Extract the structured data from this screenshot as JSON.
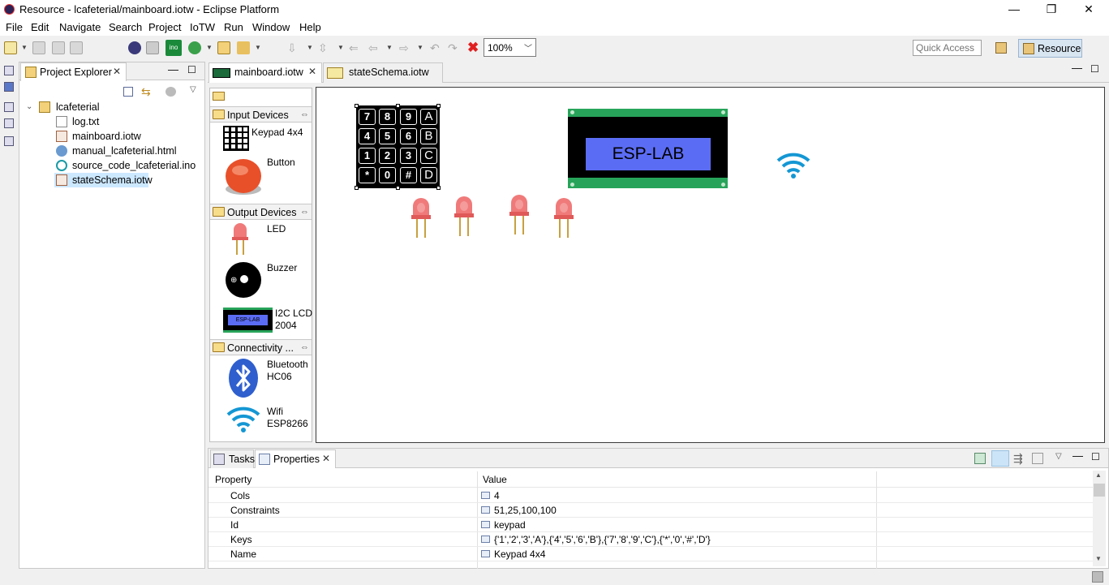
{
  "window": {
    "title": "Resource - lcafeterial/mainboard.iotw - Eclipse Platform",
    "min": "—",
    "max": "❐",
    "close": "✕"
  },
  "menu": [
    "File",
    "Edit",
    "Navigate",
    "Search",
    "Project",
    "IoTW",
    "Run",
    "Window",
    "Help"
  ],
  "toolbar": {
    "zoom": "100%",
    "quick_access_placeholder": "Quick Access",
    "perspective": "Resource"
  },
  "project_explorer": {
    "title": "Project Explorer",
    "project": "lcafeterial",
    "files": [
      "log.txt",
      "mainboard.iotw",
      "manual_lcafeterial.html",
      "source_code_lcafeterial.ino",
      "stateSchema.iotw"
    ],
    "selected": "stateSchema.iotw"
  },
  "editor": {
    "tabs": [
      "mainboard.iotw",
      "stateSchema.iotw"
    ],
    "active_tab": "mainboard.iotw"
  },
  "palette": {
    "groups": [
      {
        "title": "Input Devices",
        "items": [
          "Keypad 4x4",
          "Button"
        ]
      },
      {
        "title": "Output Devices",
        "items": [
          "LED",
          "Buzzer",
          "I2C LCD\n2004"
        ]
      },
      {
        "title": "Connectivity ...",
        "items": [
          "Bluetooth\nHC06",
          "Wifi\nESP8266"
        ]
      }
    ],
    "lcd_icon_text": "ESP-LAB"
  },
  "canvas": {
    "keypad_keys": [
      [
        "7",
        "8",
        "9",
        "A"
      ],
      [
        "4",
        "5",
        "6",
        "B"
      ],
      [
        "1",
        "2",
        "3",
        "C"
      ],
      [
        "*",
        "0",
        "#",
        "D"
      ]
    ],
    "lcd_text": "ESP-LAB",
    "led_count": 4,
    "colors": {
      "led": "#f07a7a",
      "wifi": "#1497d4",
      "lcd_board": "#27a45a",
      "lcd_screen": "#5b6cf4",
      "bluetooth": "#2f5fce"
    }
  },
  "bottom_panel": {
    "tabs": [
      "Tasks",
      "Properties"
    ],
    "active_tab": "Properties",
    "columns": [
      "Property",
      "Value"
    ],
    "rows": [
      {
        "property": "Cols",
        "value": "4"
      },
      {
        "property": "Constraints",
        "value": "51,25,100,100"
      },
      {
        "property": "Id",
        "value": "keypad"
      },
      {
        "property": "Keys",
        "value": "{'1','2','3','A'},{'4','5','6','B'},{'7','8','9','C'},{'*','0','#','D'}"
      },
      {
        "property": "Name",
        "value": "Keypad 4x4"
      }
    ]
  }
}
